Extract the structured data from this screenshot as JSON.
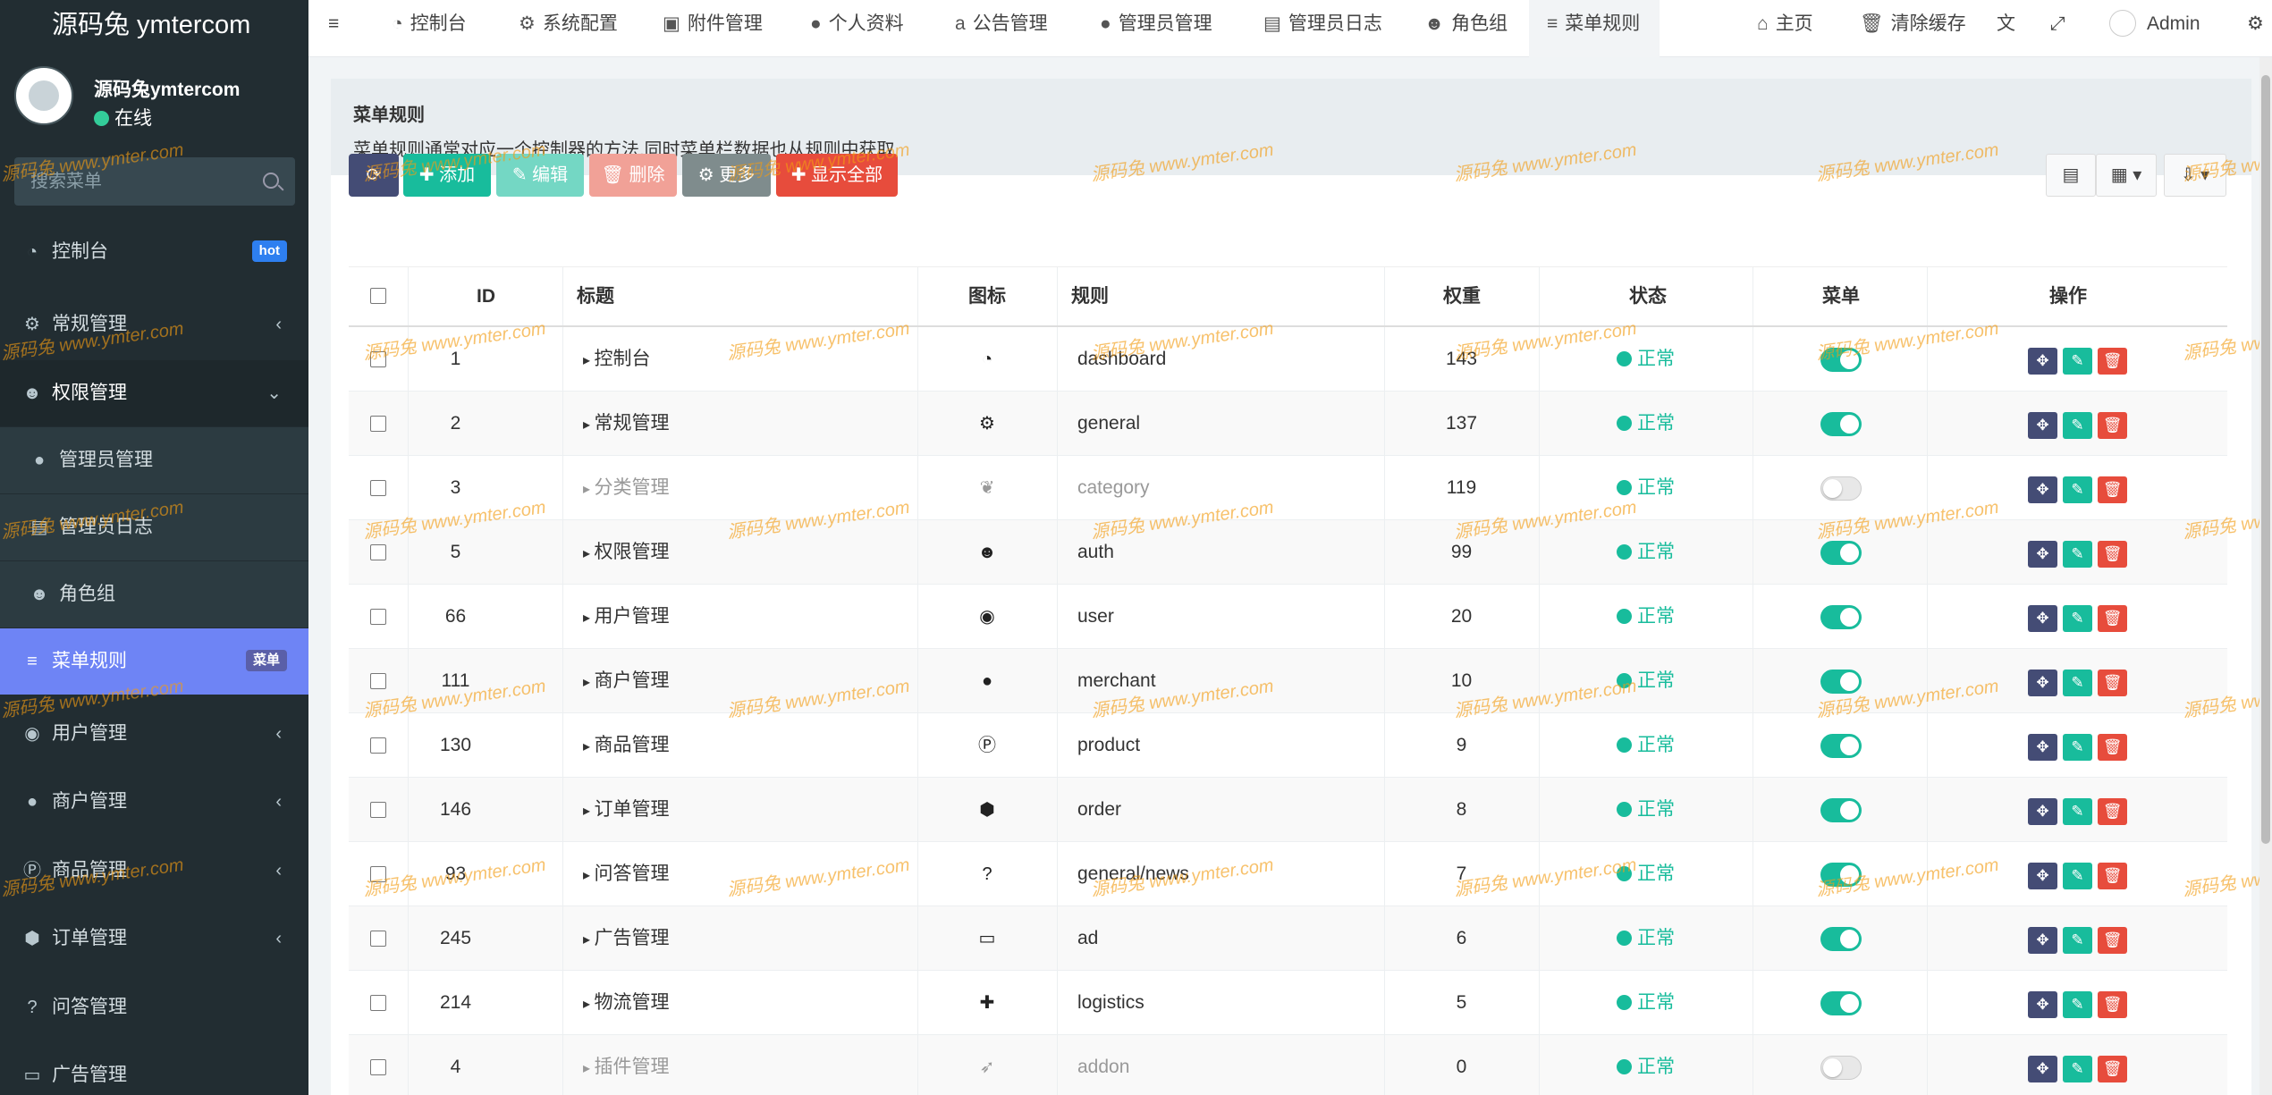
{
  "app": {
    "logo": "源码兔 ymtercom"
  },
  "user": {
    "name": "源码兔ymtercom",
    "status": "在线"
  },
  "search": {
    "placeholder": "搜索菜单"
  },
  "sidebar": {
    "items": [
      {
        "label": "控制台",
        "icon": "dashboard-icon",
        "glyph": "◔",
        "badge": "hot"
      },
      {
        "label": "常规管理",
        "icon": "cogs-icon",
        "glyph": "⚙",
        "arrow": "‹"
      },
      {
        "label": "权限管理",
        "icon": "group-icon",
        "glyph": "☻",
        "arrow": "⌄"
      },
      {
        "label": "管理员管理",
        "icon": "user-icon",
        "glyph": "●"
      },
      {
        "label": "管理员日志",
        "icon": "list-alt-icon",
        "glyph": "▤"
      },
      {
        "label": "角色组",
        "icon": "group-icon",
        "glyph": "☻"
      },
      {
        "label": "菜单规则",
        "icon": "bars-icon",
        "glyph": "≡",
        "badge": "菜单"
      },
      {
        "label": "用户管理",
        "icon": "user-circle-icon",
        "glyph": "◉",
        "arrow": "‹"
      },
      {
        "label": "商户管理",
        "icon": "apple-icon",
        "glyph": "●",
        "arrow": "‹"
      },
      {
        "label": "商品管理",
        "icon": "product-hunt-icon",
        "glyph": "Ⓟ",
        "arrow": "‹"
      },
      {
        "label": "订单管理",
        "icon": "cube-icon",
        "glyph": "⬢",
        "arrow": "‹"
      },
      {
        "label": "问答管理",
        "icon": "question-circle-icon",
        "glyph": "?"
      },
      {
        "label": "广告管理",
        "icon": "cc-amex-icon",
        "glyph": "▭"
      }
    ]
  },
  "topnav": {
    "items": [
      {
        "label": "控制台",
        "icon": "dashboard-icon",
        "glyph": "◔"
      },
      {
        "label": "系统配置",
        "icon": "cog-icon",
        "glyph": "⚙"
      },
      {
        "label": "附件管理",
        "icon": "file-image-icon",
        "glyph": "▣"
      },
      {
        "label": "个人资料",
        "icon": "user-icon",
        "glyph": "●"
      },
      {
        "label": "公告管理",
        "icon": "amazon-icon",
        "glyph": "a"
      },
      {
        "label": "管理员管理",
        "icon": "user-icon",
        "glyph": "●"
      },
      {
        "label": "管理员日志",
        "icon": "list-alt-icon",
        "glyph": "▤"
      },
      {
        "label": "角色组",
        "icon": "group-icon",
        "glyph": "☻"
      },
      {
        "label": "菜单规则",
        "icon": "bars-icon",
        "glyph": "≡"
      }
    ],
    "right": {
      "home": "主页",
      "clear_cache": "清除缓存",
      "admin": "Admin"
    }
  },
  "panel": {
    "title": "菜单规则",
    "desc": "菜单规则通常对应一个控制器的方法,同时菜单栏数据也从规则中获取"
  },
  "toolbar": {
    "add": "添加",
    "edit": "编辑",
    "delete": "删除",
    "more": "更多",
    "show_all": "显示全部"
  },
  "table": {
    "headers": {
      "id": "ID",
      "title": "标题",
      "icon": "图标",
      "rule": "规则",
      "weigh": "权重",
      "status": "状态",
      "menu": "菜单",
      "ops": "操作"
    },
    "status_text": "正常",
    "rows": [
      {
        "id": "1",
        "title": "控制台",
        "icon": "dashboard-icon",
        "glyph": "◔",
        "rule": "dashboard",
        "weigh": "143",
        "menu": true,
        "dim": false
      },
      {
        "id": "2",
        "title": "常规管理",
        "icon": "cogs-icon",
        "glyph": "⚙",
        "rule": "general",
        "weigh": "137",
        "menu": true,
        "dim": false
      },
      {
        "id": "3",
        "title": "分类管理",
        "icon": "leaf-icon",
        "glyph": "❦",
        "rule": "category",
        "weigh": "119",
        "menu": false,
        "dim": true
      },
      {
        "id": "5",
        "title": "权限管理",
        "icon": "group-icon",
        "glyph": "☻",
        "rule": "auth",
        "weigh": "99",
        "menu": true,
        "dim": false
      },
      {
        "id": "66",
        "title": "用户管理",
        "icon": "user-circle-icon",
        "glyph": "◉",
        "rule": "user",
        "weigh": "20",
        "menu": true,
        "dim": false
      },
      {
        "id": "111",
        "title": "商户管理",
        "icon": "apple-icon",
        "glyph": "●",
        "rule": "merchant",
        "weigh": "10",
        "menu": true,
        "dim": false
      },
      {
        "id": "130",
        "title": "商品管理",
        "icon": "product-hunt-icon",
        "glyph": "Ⓟ",
        "rule": "product",
        "weigh": "9",
        "menu": true,
        "dim": false
      },
      {
        "id": "146",
        "title": "订单管理",
        "icon": "cube-icon",
        "glyph": "⬢",
        "rule": "order",
        "weigh": "8",
        "menu": true,
        "dim": false
      },
      {
        "id": "93",
        "title": "问答管理",
        "icon": "question-circle-icon",
        "glyph": "?",
        "rule": "general/news",
        "weigh": "7",
        "menu": true,
        "dim": false
      },
      {
        "id": "245",
        "title": "广告管理",
        "icon": "cc-amex-icon",
        "glyph": "▭",
        "rule": "ad",
        "weigh": "6",
        "menu": true,
        "dim": false
      },
      {
        "id": "214",
        "title": "物流管理",
        "icon": "ambulance-icon",
        "glyph": "✚",
        "rule": "logistics",
        "weigh": "5",
        "menu": true,
        "dim": false
      },
      {
        "id": "4",
        "title": "插件管理",
        "icon": "rocket-icon",
        "glyph": "➶",
        "rule": "addon",
        "weigh": "0",
        "menu": false,
        "dim": true
      }
    ]
  },
  "watermark": {
    "text": "源码兔  www.ymter.com"
  },
  "colors": {
    "sidebar_bg": "#222d32",
    "active_menu": "#6e84f5",
    "success": "#18bc9c",
    "danger": "#e74c3c",
    "primary_dark": "#444c75"
  }
}
